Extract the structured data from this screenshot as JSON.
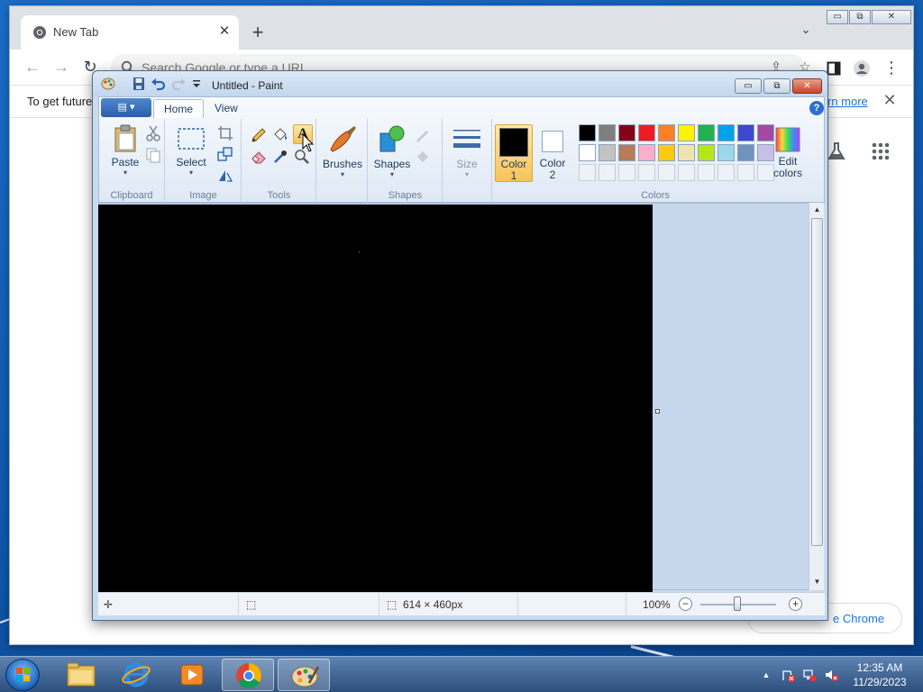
{
  "chrome": {
    "tab_title": "New Tab",
    "tab_close": "✕",
    "new_tab": "+",
    "tab_menu": "⌄",
    "win_min": "▭",
    "win_max": "⧉",
    "win_close": "✕",
    "back": "←",
    "forward": "→",
    "reload": "↻",
    "omnibox_placeholder": "Search Google or type a URL",
    "share_icon": "⇪",
    "star_icon": "☆",
    "menu_icon": "⋮",
    "infobar_text": "To get future",
    "infobar_link": "rn more",
    "infobar_close": "✕",
    "customize_text": "e Chrome"
  },
  "paint": {
    "title": "Untitled - Paint",
    "app_menu": "▤ ▾",
    "ctrl_min": "▭",
    "ctrl_max": "⧉",
    "ctrl_close": "✕",
    "tabs": [
      {
        "label": "Home"
      },
      {
        "label": "View"
      }
    ],
    "help": "?",
    "groups": {
      "clipboard": "Clipboard",
      "image": "Image",
      "tools": "Tools",
      "shapes": "Shapes",
      "colors": "Colors"
    },
    "buttons": {
      "paste": "Paste",
      "select": "Select",
      "brushes": "Brushes",
      "shapes": "Shapes",
      "size": "Size",
      "color1_line1": "Color",
      "color1_line2": "1",
      "color2_line1": "Color",
      "color2_line2": "2",
      "edit_line1": "Edit",
      "edit_line2": "colors",
      "dropdown": "▾"
    },
    "color1": "#000000",
    "color2": "#ffffff",
    "palette_row1": [
      "#000000",
      "#7f7f7f",
      "#880015",
      "#ed1c24",
      "#ff7f27",
      "#fff200",
      "#22b14c",
      "#00a2e8",
      "#3f48cc",
      "#a349a4"
    ],
    "palette_row2": [
      "#ffffff",
      "#c3c3c3",
      "#b97a57",
      "#ffaec9",
      "#ffc90e",
      "#efe4b0",
      "#b5e61d",
      "#99d9ea",
      "#7092be",
      "#c8bfe7"
    ],
    "canvas_color": "#000000",
    "status": {
      "size": "614 × 460px",
      "zoom": "100%",
      "zoom_out": "−",
      "zoom_in": "+",
      "move_icon": "✛",
      "select_icon": "⬚",
      "size_icon": "⬚"
    },
    "scroll_up": "▲",
    "scroll_down": "▼"
  },
  "taskbar": {
    "time": "12:35 AM",
    "date": "11/29/2023",
    "tray_up": "▲"
  }
}
